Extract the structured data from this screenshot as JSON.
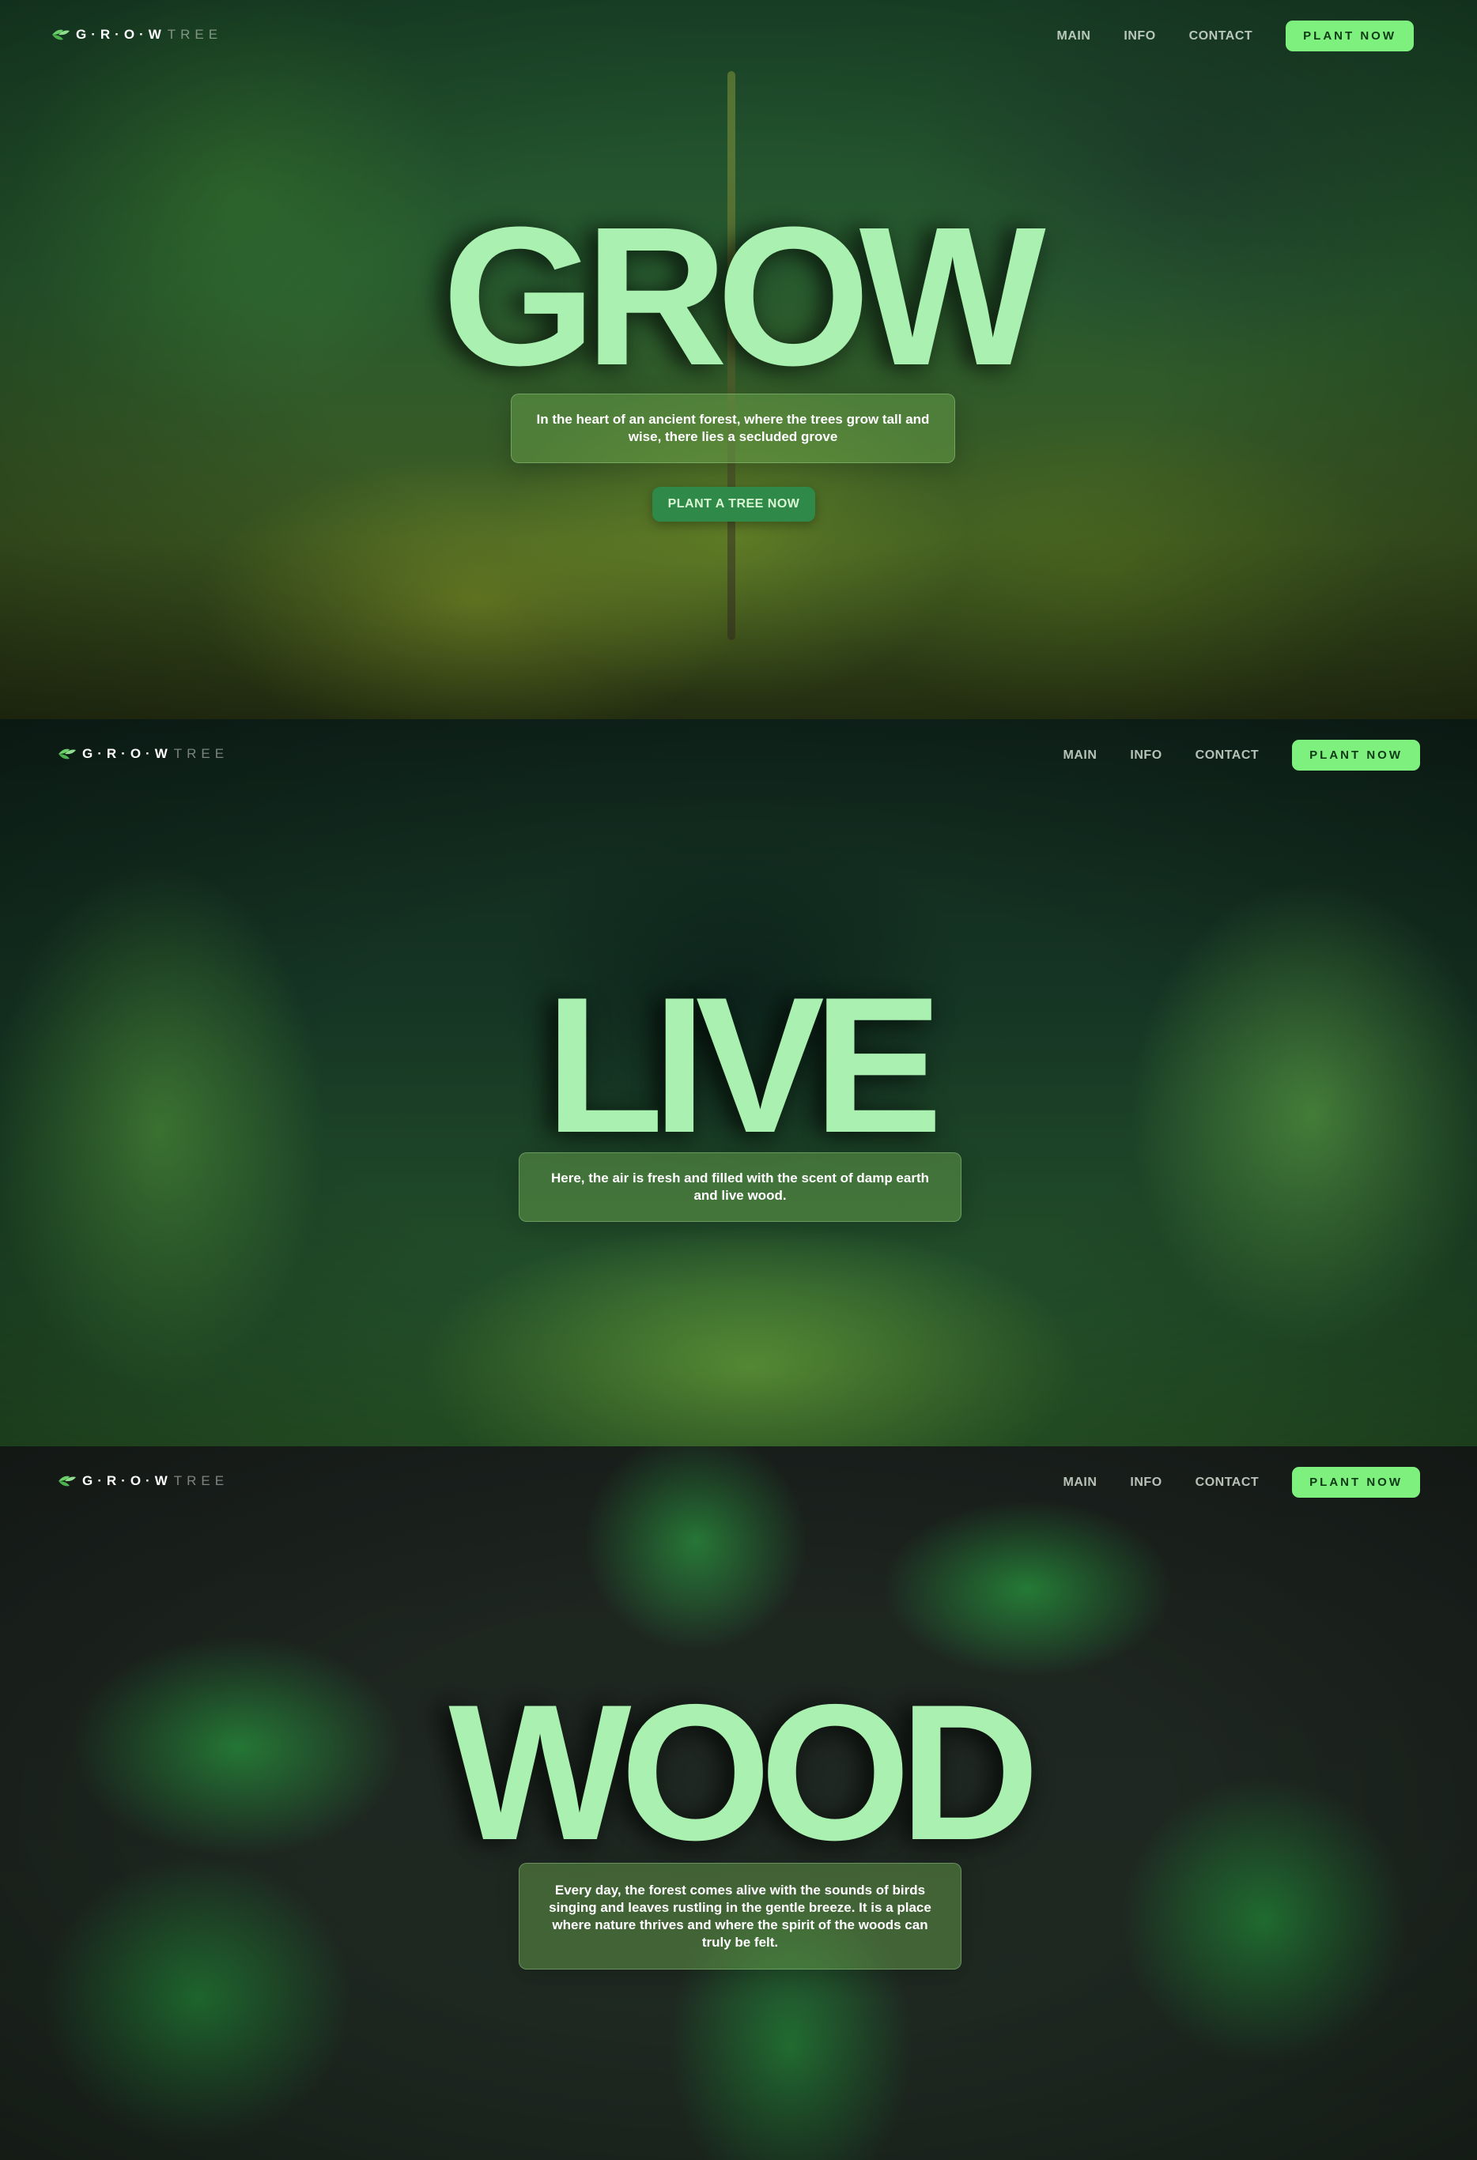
{
  "brand": {
    "grow": "G·R·O·W",
    "tree": "TREE",
    "accent": "#7ef07d"
  },
  "nav": {
    "main": "MAIN",
    "info": "INFO",
    "contact": "CONTACT",
    "cta": "PLANT NOW"
  },
  "sections": [
    {
      "headline": "GROW",
      "text": "In the heart of an ancient forest, where the trees grow tall and wise, there lies a secluded grove",
      "button": "PLANT A TREE NOW"
    },
    {
      "headline": "LIVE",
      "text": "Here, the air is fresh and filled with the scent of damp earth and live wood."
    },
    {
      "headline": "WOOD",
      "text": "Every day, the forest comes alive with the sounds of birds singing and leaves rustling in the gentle breeze. It is a place where nature thrives and where the spirit of the woods can truly be felt."
    }
  ],
  "colors": {
    "headline": "#aaf0b0",
    "cta_nav": "#7ef07d",
    "cta_hero": "#2f8a4a"
  }
}
